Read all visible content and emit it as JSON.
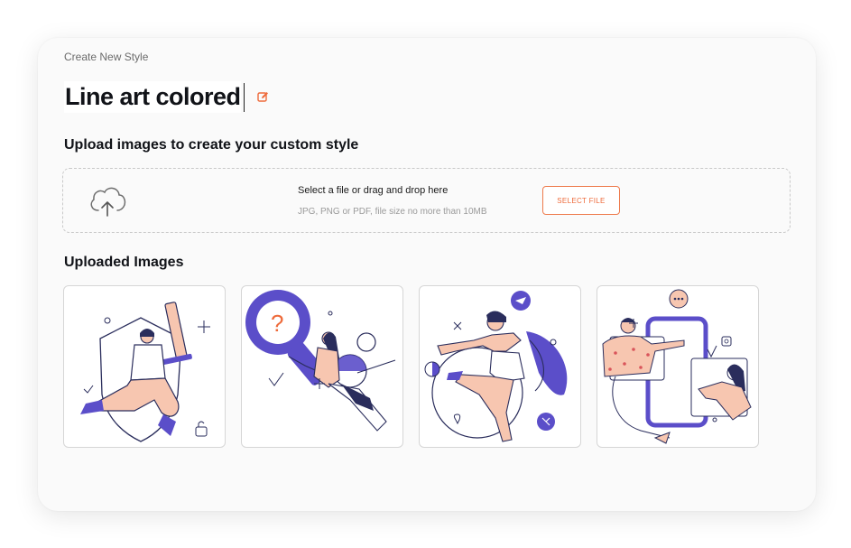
{
  "header": {
    "breadcrumb": "Create New Style",
    "style_name": "Line art colored",
    "edit_icon": "edit-icon"
  },
  "upload": {
    "heading": "Upload images to create your custom style",
    "instruction": "Select a file or drag and drop here",
    "hint": "JPG, PNG or PDF, file size no more than 10MB",
    "button_label": "SELECT FILE",
    "icon": "cloud-upload-icon"
  },
  "gallery": {
    "heading": "Uploaded Images",
    "images": [
      {
        "icon": "knight-with-sword-illustration"
      },
      {
        "icon": "person-with-magnifier-illustration"
      },
      {
        "icon": "dancing-person-illustration"
      },
      {
        "icon": "phone-chat-illustration"
      }
    ]
  },
  "colors": {
    "accent": "#ee6a3a",
    "illustration_purple": "#5b4ec9",
    "illustration_peach": "#f7c6b0",
    "illustration_navy": "#2a2d5c"
  }
}
